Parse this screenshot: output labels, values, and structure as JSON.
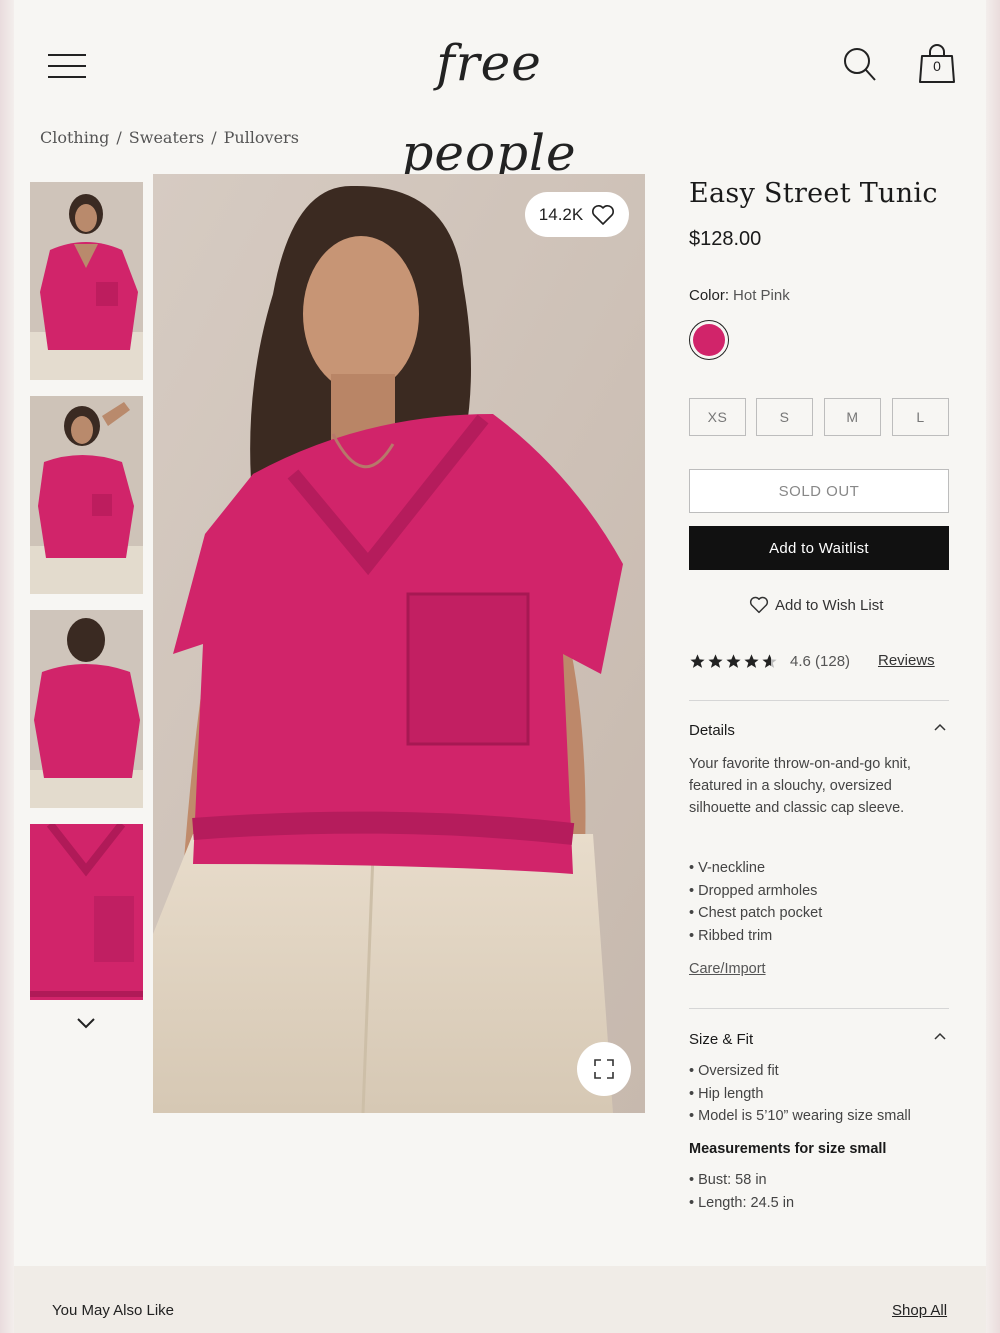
{
  "header": {
    "logo_text": "free people",
    "bag_count": "0"
  },
  "breadcrumb": [
    "Clothing",
    "Sweaters",
    "Pullovers"
  ],
  "gallery": {
    "likes": "14.2K"
  },
  "product": {
    "title": "Easy Street Tunic",
    "price": "$128.00",
    "color_label": "Color:",
    "color_value": "Hot Pink",
    "swatch_color": "#d1246a",
    "sizes": [
      "XS",
      "S",
      "M",
      "L"
    ],
    "sold_out_label": "SOLD OUT",
    "waitlist_label": "Add to Waitlist",
    "wishlist_label": "Add to Wish List",
    "rating_value": "4.6",
    "rating_count": "(128)",
    "reviews_label": "Reviews"
  },
  "details": {
    "heading": "Details",
    "description": "Your favorite throw-on-and-go knit, featured in a slouchy, oversized silhouette and classic cap sleeve.",
    "bullets": [
      "V-neckline",
      "Dropped armholes",
      "Chest patch pocket",
      "Ribbed trim"
    ],
    "care_link": "Care/Import"
  },
  "size_fit": {
    "heading": "Size & Fit",
    "bullets": [
      "Oversized fit",
      "Hip length",
      "Model is 5’10” wearing size small"
    ],
    "measurements_title": "Measurements for size small",
    "measurements": [
      "Bust: 58 in",
      "Length: 24.5 in"
    ]
  },
  "recommendations": {
    "title": "You May Also Like",
    "shop_all": "Shop All"
  },
  "colors": {
    "accent_pink": "#d1246a",
    "button_black": "#111111",
    "background": "#f7f6f3"
  }
}
